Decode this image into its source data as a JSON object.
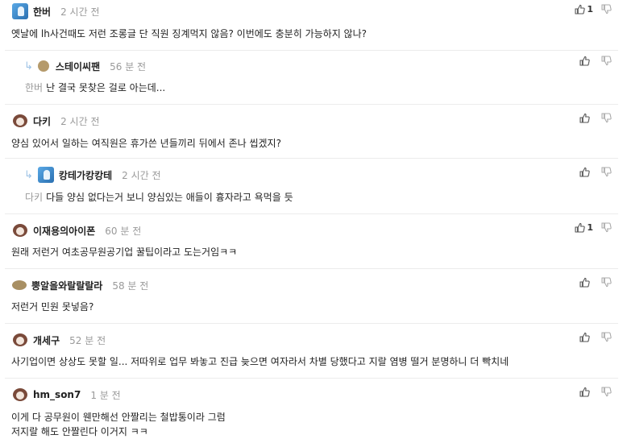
{
  "comments": [
    {
      "author": "한버",
      "time": "2 시간 전",
      "mention": "",
      "lines": [
        "옛날에 lh사건때도 저런 조롱글 단 직원 징계먹지 않음? 이번에도 충분히 가능하지 않나?"
      ],
      "likes": "1",
      "avatar": "blue-avatar-icon"
    },
    {
      "author": "스테이씨팬",
      "time": "56 분 전",
      "mention": "한버",
      "lines": [
        "난 결국 못찾은 걸로 아는데..."
      ],
      "likes": "",
      "avatar": "tan-dot-avatar-icon"
    },
    {
      "author": "다키",
      "time": "2 시간 전",
      "mention": "",
      "lines": [
        "양심 있어서 일하는 여직원은 휴가쓴 년들끼리 뒤에서 존나 씹겠지?"
      ],
      "likes": "",
      "avatar": "dog-avatar-icon"
    },
    {
      "author": "캉테가캉캉테",
      "time": "2 시간 전",
      "mention": "다키",
      "lines": [
        "다들 양심 없다는거 보니 양심있는 애들이 흉자라고 욕먹을 듯"
      ],
      "likes": "",
      "avatar": "blue-avatar-icon"
    },
    {
      "author": "이재용의아이폰",
      "time": "60 분 전",
      "mention": "",
      "lines": [
        "원래 저런거 여초공무원공기업 꿀팁이라고 도는거임ㅋㅋ"
      ],
      "likes": "1",
      "avatar": "dog-avatar-icon"
    },
    {
      "author": "뿡알을와랄랄랄라",
      "time": "58 분 전",
      "mention": "",
      "lines": [
        "저런거 민원 못넣음?"
      ],
      "likes": "",
      "avatar": "tan-oval-avatar-icon"
    },
    {
      "author": "개세구",
      "time": "52 분 전",
      "mention": "",
      "lines": [
        "사기업이면 상상도 못할 일... 저따위로 업무 봐놓고 진급 늦으면 여자라서 차별 당했다고 지랄 염병 떨거 분명하니 더 빡치네"
      ],
      "likes": "",
      "avatar": "dog-avatar-icon"
    },
    {
      "author": "hm_son7",
      "time": "1 분 전",
      "mention": "",
      "lines": [
        "이게 다 공무원이 웬만해선 안짤리는 철밥통이라 그럼",
        "저지랄 해도 안짤린다 이거지 ㅋㅋ"
      ],
      "likes": "",
      "avatar": "dog-avatar-icon"
    }
  ]
}
